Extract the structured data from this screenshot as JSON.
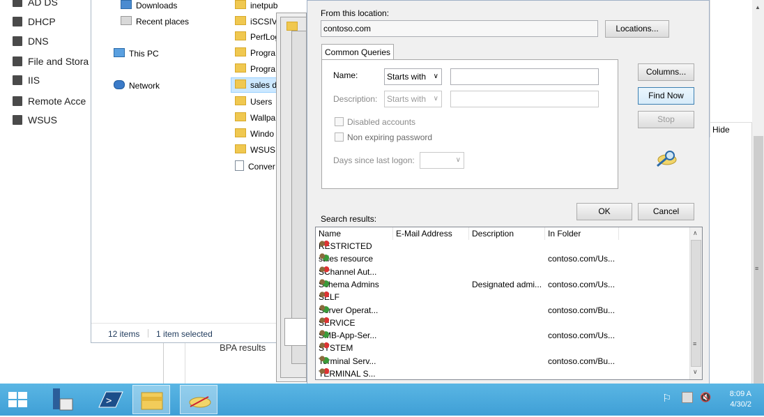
{
  "server_nav": {
    "items": [
      "AD DS",
      "DHCP",
      "DNS",
      "File and Stora",
      "IIS",
      "Remote Acce",
      "WSUS"
    ]
  },
  "explorer": {
    "nav": {
      "downloads": "Downloads",
      "recent": "Recent places",
      "this_pc": "This PC",
      "network": "Network"
    },
    "files": [
      "inetpub",
      "iSCSIVi",
      "PerfLog",
      "Progra",
      "Progra",
      "sales d",
      "Users",
      "Wallpa",
      "Windo",
      "WSUS",
      "Conver"
    ],
    "status": {
      "count": "12 items",
      "selection": "1 item selected"
    }
  },
  "background": {
    "bpa_results": "BPA results",
    "hide": "Hide"
  },
  "dialog": {
    "from_location_label": "From this location:",
    "location_value": "contoso.com",
    "locations_button": "Locations...",
    "tab_label": "Common Queries",
    "name_label": "Name:",
    "name_mode": "Starts with",
    "name_value": "",
    "description_label": "Description:",
    "description_mode": "Starts with",
    "description_value": "",
    "disabled_accounts": "Disabled accounts",
    "non_expiring": "Non expiring password",
    "days_label": "Days since last logon:",
    "days_value": "",
    "columns_button": "Columns...",
    "find_now_button": "Find Now",
    "stop_button": "Stop",
    "ok_button": "OK",
    "cancel_button": "Cancel",
    "search_results_label": "Search results:",
    "columns": [
      "Name",
      "E-Mail Address",
      "Description",
      "In Folder"
    ],
    "rows": [
      {
        "name": "RESTRICTED",
        "email": "",
        "description": "",
        "folder": "",
        "icon": "red"
      },
      {
        "name": "sales resource",
        "email": "",
        "description": "",
        "folder": "contoso.com/Us...",
        "icon": "grn"
      },
      {
        "name": "SChannel Aut...",
        "email": "",
        "description": "",
        "folder": "",
        "icon": "red"
      },
      {
        "name": "Schema Admins",
        "email": "",
        "description": "Designated admi...",
        "folder": "contoso.com/Us...",
        "icon": "grn"
      },
      {
        "name": "SELF",
        "email": "",
        "description": "",
        "folder": "",
        "icon": "red"
      },
      {
        "name": "Server Operat...",
        "email": "",
        "description": "",
        "folder": "contoso.com/Bu...",
        "icon": "grn"
      },
      {
        "name": "SERVICE",
        "email": "",
        "description": "",
        "folder": "",
        "icon": "red"
      },
      {
        "name": "SMB-App-Ser...",
        "email": "",
        "description": "",
        "folder": "contoso.com/Us...",
        "icon": "grn"
      },
      {
        "name": "SYSTEM",
        "email": "",
        "description": "",
        "folder": "",
        "icon": "red"
      },
      {
        "name": "Terminal Serv...",
        "email": "",
        "description": "",
        "folder": "contoso.com/Bu...",
        "icon": "grn"
      },
      {
        "name": "TERMINAL S...",
        "email": "",
        "description": "",
        "folder": "",
        "icon": "red"
      }
    ]
  },
  "taskbar": {
    "time": "8:09 A",
    "date": "4/30/2"
  }
}
